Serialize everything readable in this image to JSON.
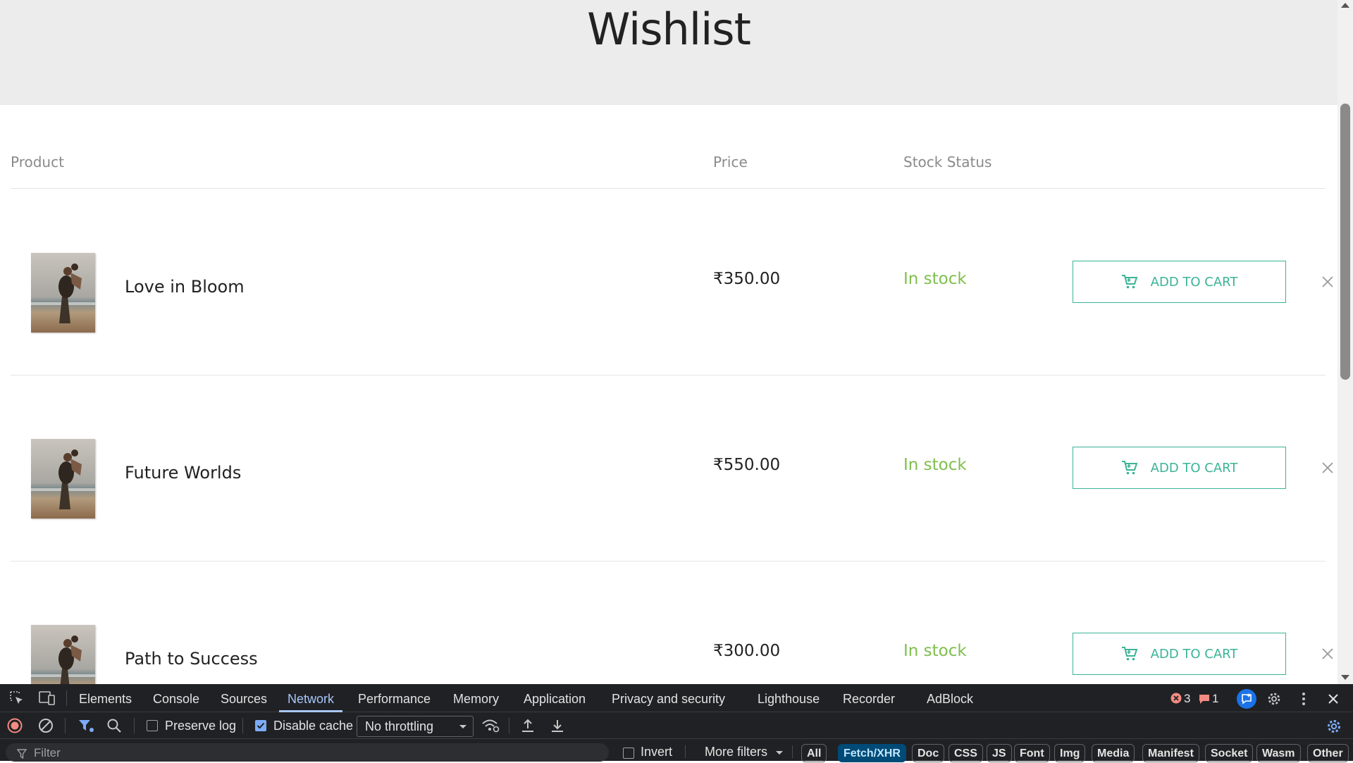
{
  "page": {
    "title": "Wishlist",
    "columns": {
      "product": "Product",
      "price": "Price",
      "stock_status": "Stock Status"
    },
    "items": [
      {
        "name": "Love in Bloom",
        "price": "₹350.00",
        "stock": "In stock",
        "action": "ADD TO CART"
      },
      {
        "name": "Future Worlds",
        "price": "₹550.00",
        "stock": "In stock",
        "action": "ADD TO CART"
      },
      {
        "name": "Path to Success",
        "price": "₹300.00",
        "stock": "In stock",
        "action": "ADD TO CART"
      }
    ]
  },
  "colors": {
    "accent": "#3bb397",
    "in_stock": "#7fbf4d",
    "hero_bg": "#ececec",
    "devtools_bg": "#202124"
  },
  "devtools": {
    "tabs": [
      "Elements",
      "Console",
      "Sources",
      "Network",
      "Performance",
      "Memory",
      "Application",
      "Privacy and security",
      "Lighthouse",
      "Recorder",
      "AdBlock"
    ],
    "active_tab": "Network",
    "error_count": "3",
    "message_count": "1",
    "toolbar": {
      "preserve_log": "Preserve log",
      "disable_cache": "Disable cache",
      "throttling": "No throttling"
    },
    "filter": {
      "placeholder": "Filter",
      "invert": "Invert",
      "more_filters": "More filters",
      "types": [
        "All",
        "Fetch/XHR",
        "Doc",
        "CSS",
        "JS",
        "Font",
        "Img",
        "Media",
        "Manifest",
        "Socket",
        "Wasm",
        "Other"
      ],
      "active_type": "Fetch/XHR"
    }
  }
}
